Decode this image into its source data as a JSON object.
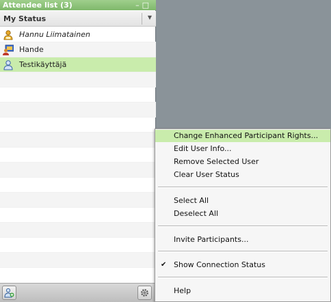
{
  "panel": {
    "title": "Attendee list (3)",
    "window_buttons": "–□",
    "status_label": "My Status",
    "status_dropdown_arrow": "▼"
  },
  "attendees": [
    {
      "name": "Hannu Liimatainen",
      "icon": "presenter-icon",
      "italic": true
    },
    {
      "name": "Hande",
      "icon": "screen-share-user-icon",
      "italic": false
    },
    {
      "name": "Testikäyttäjä",
      "icon": "user-icon",
      "italic": false,
      "selected": true
    }
  ],
  "bottom": {
    "add_icon": "add-participant-icon",
    "settings_icon": "settings-gear-icon"
  },
  "context_menu": {
    "items": [
      {
        "label": "Change Enhanced Participant Rights...",
        "highlighted": true
      },
      {
        "label": "Edit User Info..."
      },
      {
        "label": "Remove Selected User"
      },
      {
        "label": "Clear User Status"
      },
      {
        "label": "Select All"
      },
      {
        "label": "Deselect All"
      },
      {
        "label": "Invite Participants..."
      },
      {
        "label": "Show Connection Status",
        "checked": true,
        "check": "✔"
      },
      {
        "label": "Help"
      }
    ]
  },
  "colors": {
    "title_bg": "#8cc276",
    "selection": "#c9ecac",
    "backdrop": "#8a9399"
  }
}
